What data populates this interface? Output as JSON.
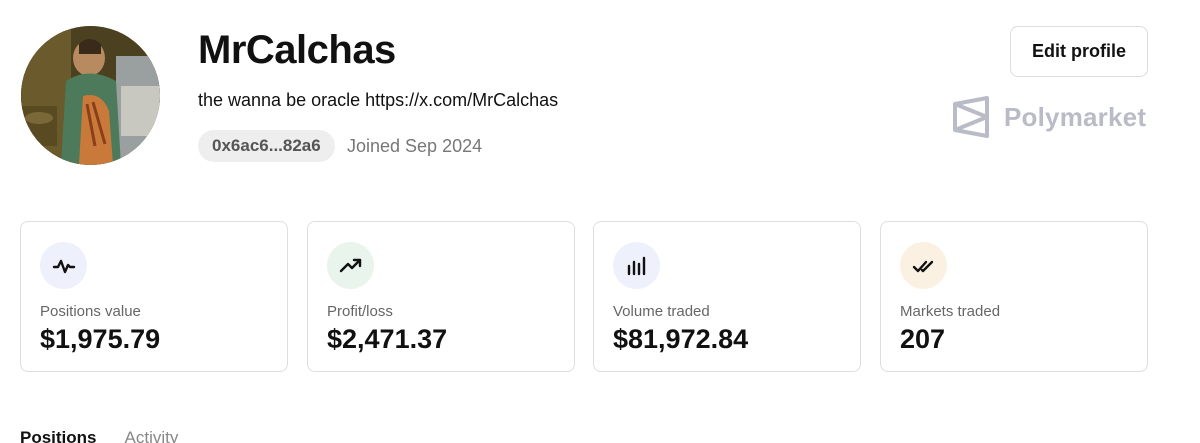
{
  "profile": {
    "username": "MrCalchas",
    "bio": "the wanna be oracle https://x.com/MrCalchas",
    "address": "0x6ac6...82a6",
    "joined": "Joined Sep 2024"
  },
  "header": {
    "edit_profile_label": "Edit profile",
    "brand_name": "Polymarket"
  },
  "stats": [
    {
      "label": "Positions value",
      "value": "$1,975.79",
      "icon": "activity-icon",
      "icon_bg": "#eef1fb"
    },
    {
      "label": "Profit/loss",
      "value": "$2,471.37",
      "icon": "trending-up-icon",
      "icon_bg": "#e8f4ec"
    },
    {
      "label": "Volume traded",
      "value": "$81,972.84",
      "icon": "bar-chart-icon",
      "icon_bg": "#eef1fb"
    },
    {
      "label": "Markets traded",
      "value": "207",
      "icon": "double-check-icon",
      "icon_bg": "#fbf1e3"
    }
  ],
  "tabs": [
    {
      "label": "Positions",
      "active": true
    },
    {
      "label": "Activity",
      "active": false
    }
  ],
  "colors": {
    "brand_gray": "#b9bcc6",
    "card_border": "#dedede"
  }
}
